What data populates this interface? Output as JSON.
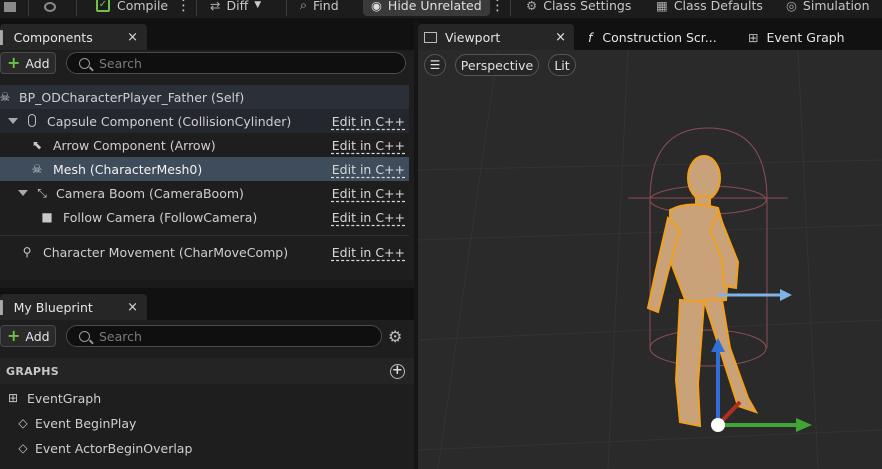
{
  "toolbar": {
    "compile_label": "Compile",
    "diff_label": "Diff",
    "find_label": "Find",
    "hide_unrelated_label": "Hide Unrelated",
    "class_settings_label": "Class Settings",
    "class_defaults_label": "Class Defaults",
    "simulation_label": "Simulation"
  },
  "components_panel": {
    "tab_label": "Components",
    "close_glyph": "×",
    "add_label": "Add",
    "search_placeholder": "Search",
    "items": [
      {
        "label": "BP_ODCharacterPlayer_Father (Self)",
        "edit": ""
      },
      {
        "label": "Capsule Component (CollisionCylinder)",
        "edit": "Edit in C++"
      },
      {
        "label": "Arrow Component (Arrow)",
        "edit": "Edit in C++"
      },
      {
        "label": "Mesh (CharacterMesh0)",
        "edit": "Edit in C++"
      },
      {
        "label": "Camera Boom (CameraBoom)",
        "edit": "Edit in C++"
      },
      {
        "label": "Follow Camera (FollowCamera)",
        "edit": "Edit in C++"
      },
      {
        "label": "Character Movement (CharMoveComp)",
        "edit": "Edit in C++"
      }
    ]
  },
  "blueprint_panel": {
    "tab_label": "My Blueprint",
    "close_glyph": "×",
    "add_label": "Add",
    "search_placeholder": "Search",
    "graphs_header": "GRAPHS",
    "items": [
      {
        "label": "EventGraph"
      },
      {
        "label": "Event BeginPlay"
      },
      {
        "label": "Event ActorBeginOverlap"
      }
    ]
  },
  "viewport": {
    "tabs": [
      {
        "label": "Viewport",
        "close": "×"
      },
      {
        "label": "Construction Scr...",
        "icon": "f"
      },
      {
        "label": "Event Graph"
      }
    ],
    "perspective_label": "Perspective",
    "lit_label": "Lit"
  },
  "colors": {
    "selection": "#3e4c5c",
    "add_plus": "#6cc24a",
    "axis_x": "#3fa535",
    "axis_y": "#2f6fd6",
    "axis_z": "#b03020",
    "mannequin": "#c9a27a",
    "outline": "#f0a020"
  }
}
